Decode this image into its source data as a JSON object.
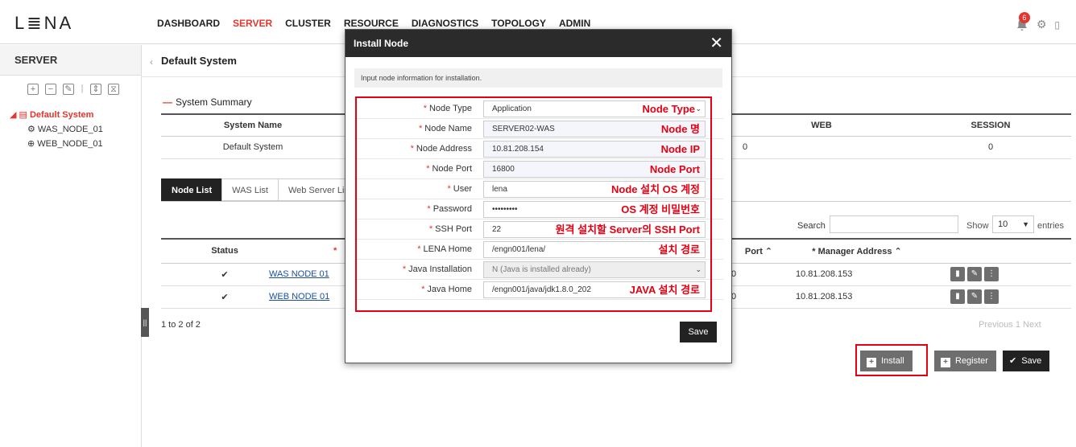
{
  "app": {
    "logo": "L≣NA"
  },
  "nav": {
    "items": [
      "DASHBOARD",
      "SERVER",
      "CLUSTER",
      "RESOURCE",
      "DIAGNOSTICS",
      "TOPOLOGY",
      "ADMIN"
    ],
    "active": "SERVER"
  },
  "notifications": {
    "count": "6"
  },
  "sidebar": {
    "title": "SERVER",
    "tree": {
      "root": "Default System",
      "children": [
        "WAS_NODE_01",
        "WEB_NODE_01"
      ]
    }
  },
  "main": {
    "title": "Default System",
    "summary_label": "System Summary",
    "summary_table": {
      "headers": [
        "System Name",
        "",
        "WEB",
        "SESSION"
      ],
      "row": [
        "Default System",
        "",
        "0",
        "0"
      ]
    },
    "tabs": [
      "Node List",
      "WAS List",
      "Web Server Lis"
    ],
    "search_label": "Search",
    "show_label": "Show",
    "show_value": "10",
    "entries_label": "entries",
    "node_table": {
      "headers": [
        "",
        "Status",
        "*",
        "Port",
        "* Manager Address",
        ""
      ],
      "rows": [
        {
          "name": "WAS NODE 01",
          "port": "0",
          "manager": "10.81.208.153"
        },
        {
          "name": "WEB NODE 01",
          "port": "0",
          "manager": "10.81.208.153"
        }
      ]
    },
    "page_info": "1 to 2 of 2",
    "pager": "Previous  1  Next",
    "buttons": {
      "install": "Install",
      "register": "Register",
      "save": "Save"
    }
  },
  "modal": {
    "title": "Install Node",
    "info": "Input node information for installation.",
    "fields": [
      {
        "label": "Node Type",
        "value": "Application",
        "anno": "Node Type"
      },
      {
        "label": "Node Name",
        "value": "SERVER02-WAS",
        "anno": "Node 명"
      },
      {
        "label": "Node Address",
        "value": "10.81.208.154",
        "anno": "Node IP"
      },
      {
        "label": "Node Port",
        "value": "16800",
        "anno": "Node Port"
      },
      {
        "label": "User",
        "value": "lena",
        "anno": "Node 설치 OS 계정"
      },
      {
        "label": "Password",
        "value": "•••••••••",
        "anno": "OS 계정 비밀번호"
      },
      {
        "label": "SSH Port",
        "value": "22",
        "anno": "원격 설치할 Server의 SSH Port"
      },
      {
        "label": "LENA Home",
        "value": "/engn001/lena/",
        "anno": "설치 경로"
      },
      {
        "label": "Java Installation",
        "value": "N (Java is installed already)",
        "anno": ""
      },
      {
        "label": "Java Home",
        "value": "/engn001/java/jdk1.8.0_202",
        "anno": "JAVA 설치 경로"
      }
    ],
    "save": "Save"
  },
  "colors": {
    "accent": "#e4352e",
    "annotation": "#e60012",
    "dark": "#222222"
  }
}
